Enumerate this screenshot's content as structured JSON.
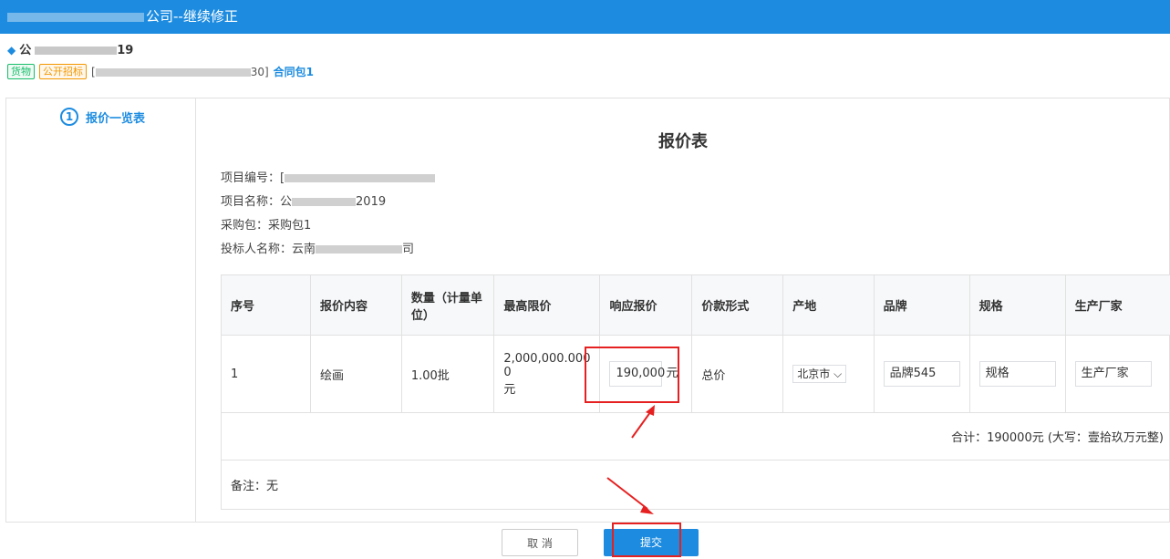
{
  "header": {
    "title_suffix": "公司--继续修正"
  },
  "crumb": {
    "project_prefix": "公",
    "project_suffix": "19"
  },
  "tags": {
    "goods": "货物",
    "method": "公开招标"
  },
  "package": {
    "code_prefix": "[",
    "code_suffix": "30]",
    "link": "合同包1"
  },
  "sidebar": {
    "step_number": "1",
    "step_label": "报价一览表"
  },
  "form": {
    "title": "报价表",
    "project_no_label": "项目编号：",
    "project_no_value": "[",
    "project_name_label": "项目名称：",
    "project_name_value": "公",
    "project_name_suffix": "2019",
    "package_label": "采购包：",
    "package_value": "采购包1",
    "bidder_label": "投标人名称：",
    "bidder_value": "云南",
    "bidder_suffix": "司"
  },
  "table": {
    "headers": [
      "序号",
      "报价内容",
      "数量（计量单位）",
      "最高限价",
      "响应报价",
      "价款形式",
      "产地",
      "品牌",
      "规格",
      "生产厂家"
    ],
    "row": {
      "index": "1",
      "content": "绘画",
      "quantity": "1.00批",
      "max_price_line1": "2,000,000.000",
      "max_price_line2": "0",
      "max_price_unit": "元",
      "response_price": "190,000",
      "response_unit": "元",
      "payment_form": "总价",
      "origin": "北京市",
      "brand": "品牌545",
      "spec": "规格",
      "manufacturer": "生产厂家"
    },
    "total_text": "合计：190000元 (大写：壹拾玖万元整)",
    "remark_text": "备注：无"
  },
  "buttons": {
    "cancel": "取 消",
    "submit": "提交"
  },
  "colors": {
    "primary": "#1d8ce0",
    "annotation_red": "#e62020"
  }
}
